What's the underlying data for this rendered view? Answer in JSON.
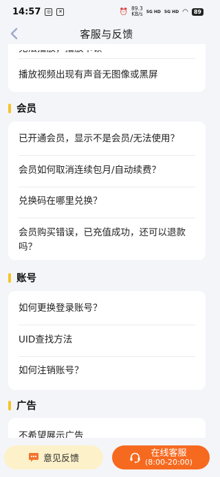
{
  "status_bar": {
    "time": "14:57",
    "net_speed_value": "89.3",
    "net_speed_unit": "KB/s",
    "sig1": "5G HD",
    "sig2": "5G HD",
    "battery": "89"
  },
  "header": {
    "title": "客服与反馈"
  },
  "top_section": {
    "partial_item": "无法播放，播放卡顿",
    "items": [
      "播放视频出现有声音无图像或黑屏"
    ]
  },
  "sections": [
    {
      "title": "会员",
      "items": [
        "已开通会员，显示不是会员/无法使用？",
        "会员如何取消连续包月/自动续费？",
        "兑换码在哪里兑换？",
        "会员购买错误，已充值成功，还可以退款吗？"
      ]
    },
    {
      "title": "账号",
      "items": [
        "如何更换登录账号？",
        "UID查找方法",
        "如何注销账号？"
      ]
    },
    {
      "title": "广告",
      "items": [
        "不希望展示广告"
      ]
    }
  ],
  "bottom": {
    "feedback_label": "意见反馈",
    "service_label": "在线客服",
    "service_hours": "(8:00-20:00)"
  },
  "colors": {
    "accent": "#f7c325",
    "service": "#f66a20",
    "feedback_bg": "#fdf1c9"
  }
}
